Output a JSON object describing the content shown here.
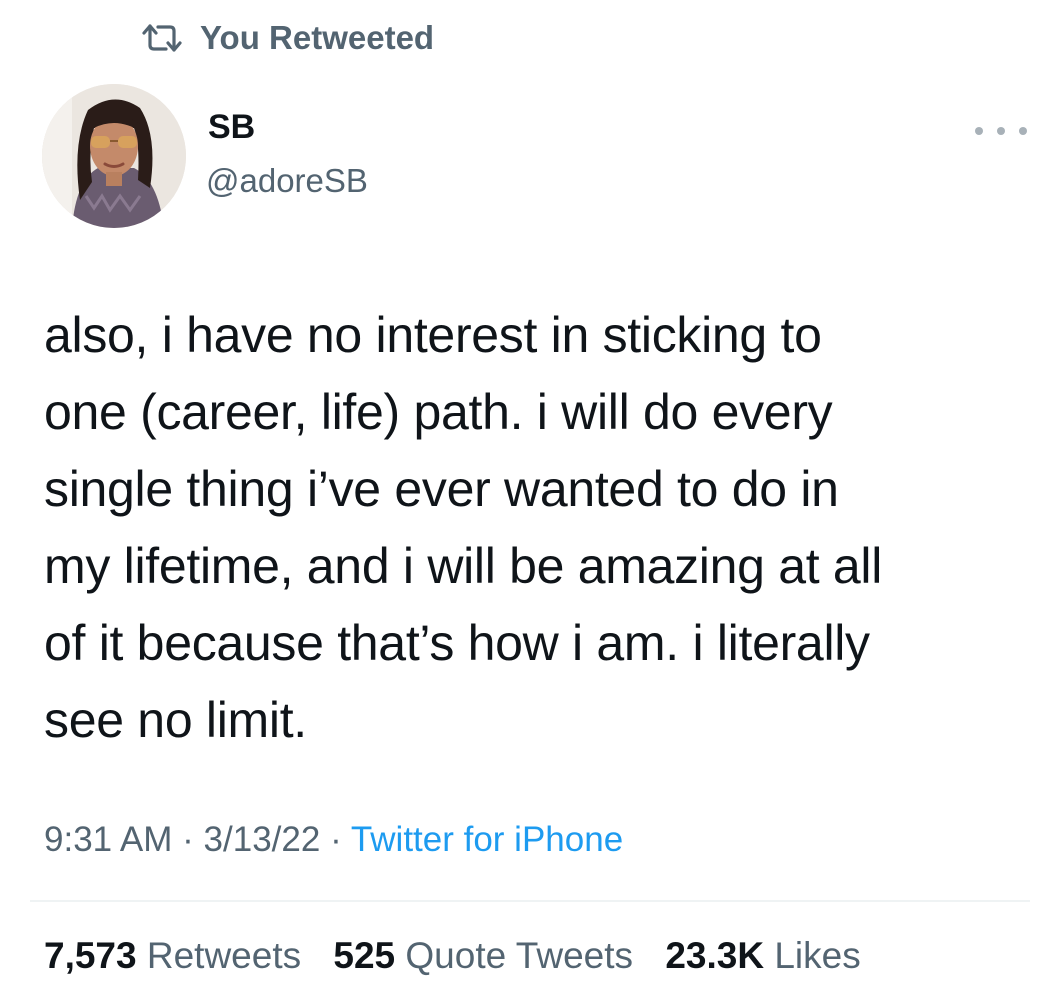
{
  "social_context": {
    "icon": "retweet-icon",
    "label": "You Retweeted"
  },
  "author": {
    "display_name": "SB",
    "handle": "@adoreSB",
    "avatar": "avatar-photo"
  },
  "more_menu": {
    "icon": "more-horizontal-icon"
  },
  "tweet": {
    "text": "also, i have no interest in sticking to\none (career, life) path. i will do every\nsingle thing i’ve ever wanted to do in\nmy lifetime, and i will be amazing at all\nof it because that’s how i am. i literally\nsee no limit."
  },
  "meta": {
    "time": "9:31 AM",
    "date": "3/13/22",
    "separator": "·",
    "source": "Twitter for iPhone"
  },
  "stats": {
    "retweets_count": "7,573",
    "retweets_label": "Retweets",
    "quotes_count": "525",
    "quotes_label": "Quote Tweets",
    "likes_count": "23.3K",
    "likes_label": "Likes"
  },
  "colors": {
    "text_primary": "#0f1419",
    "text_secondary": "#536471",
    "link": "#1d9bf0",
    "divider": "#eff3f4"
  }
}
